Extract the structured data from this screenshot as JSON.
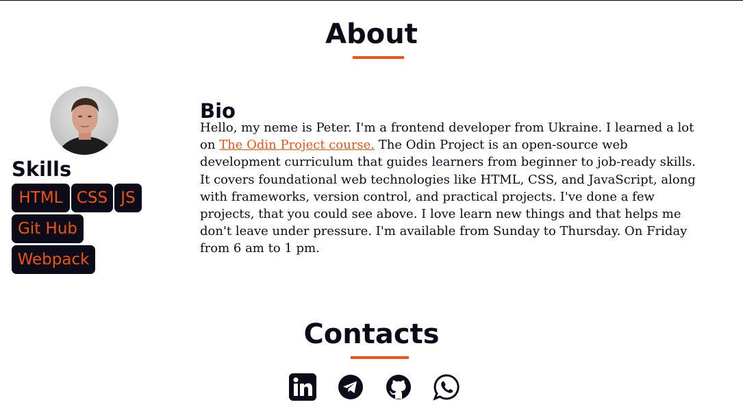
{
  "about": {
    "title": "About",
    "accent_color": "#f0520f"
  },
  "profile": {
    "avatar_alt": "avatar",
    "skills_heading": "Skills",
    "skills": [
      "HTML",
      "CSS",
      "JS",
      "Git Hub",
      "Webpack"
    ]
  },
  "bio": {
    "heading": "Bio",
    "text_before_link": "Hello, my neme is Peter. I'm a frontend developer from Ukraine. I learned a lot on ",
    "link_text": "The Odin Project course.",
    "text_after_link": " The Odin Project is an open-source web development curriculum that guides learners from beginner to job-ready skills. It covers foundational web technologies like HTML, CSS, and JavaScript, along with frameworks, version control, and practical projects. I've done a few projects, that you could see above. I love learn new things and that helps me don't leave under pressure. I'm available from Sunday to Thursday. On Friday from 6 am to 1 pm."
  },
  "contacts": {
    "title": "Contacts",
    "icons": [
      "linkedin-icon",
      "telegram-icon",
      "github-icon",
      "whatsapp-icon"
    ]
  },
  "colors": {
    "dark": "#0b0b1a",
    "accent": "#f0520f"
  }
}
